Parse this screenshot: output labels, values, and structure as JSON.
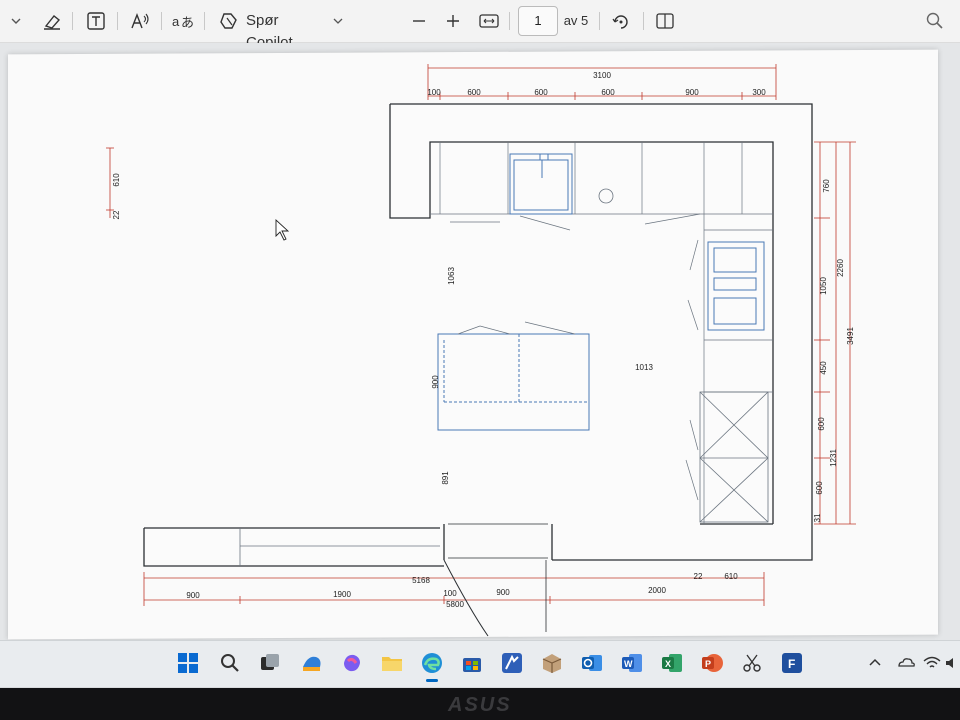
{
  "toolbar": {
    "copilot_label": "Spør Copilot",
    "page_current": "1",
    "page_total_label": "av 5"
  },
  "drawing": {
    "top_total": "3100",
    "top_parts": [
      "100",
      "600",
      "600",
      "600",
      "900",
      "300"
    ],
    "left_dims": [
      "610",
      "22"
    ],
    "vertical_inner": [
      "1063",
      "900",
      "891"
    ],
    "island_to_wall": "1013",
    "right_dims_a": [
      "760",
      "1050",
      "450",
      "600",
      "600",
      "31"
    ],
    "right_dims_b": [
      "2260",
      "1231"
    ],
    "right_total": "3491",
    "bottom_total": "5168",
    "bottom_parts": [
      "900",
      "1900",
      "100",
      "900",
      "2000"
    ],
    "bottom_small": [
      "22",
      "610"
    ],
    "bottom_overall": "5800"
  },
  "brand": {
    "laptop": "ASUS"
  },
  "colors": {
    "dim_line": "#c0392b",
    "wall": "#2b2f33",
    "cabinet_blue": "#4a78b5",
    "accent_taskbar": "#0067c0"
  }
}
